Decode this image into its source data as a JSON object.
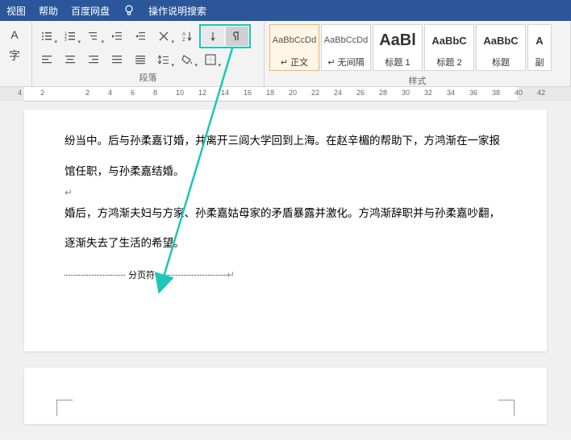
{
  "menubar": {
    "items": [
      "视图",
      "帮助",
      "百度网盘"
    ],
    "tell_me": "操作说明搜索"
  },
  "ribbon": {
    "paragraph_label": "段落",
    "styles_label": "样式"
  },
  "styles": [
    {
      "preview": "AaBbCcDd",
      "label": "↵ 正文",
      "big": false,
      "heading": false,
      "active": true
    },
    {
      "preview": "AaBbCcDd",
      "label": "↵ 无间隔",
      "big": false,
      "heading": false,
      "active": false
    },
    {
      "preview": "AaBl",
      "label": "标题 1",
      "big": true,
      "heading": false,
      "active": false
    },
    {
      "preview": "AaBbC",
      "label": "标题 2",
      "big": false,
      "heading": true,
      "active": false
    },
    {
      "preview": "AaBbC",
      "label": "标题",
      "big": false,
      "heading": true,
      "active": false
    },
    {
      "preview": "A",
      "label": "副",
      "big": false,
      "heading": true,
      "active": false
    }
  ],
  "ruler_marks": [
    -4,
    -2,
    2,
    4,
    6,
    8,
    10,
    12,
    14,
    16,
    18,
    20,
    22,
    24,
    26,
    28,
    30,
    32,
    34,
    36,
    38,
    40,
    42
  ],
  "document": {
    "para1": "纷当中。后与孙柔嘉订婚，并离开三闾大学回到上海。在赵辛楣的帮助下，方鸿渐在一家报馆任职，与孙柔嘉结婚。",
    "para2": "婚后，方鸿渐夫妇与方家、孙柔嘉姑母家的矛盾暴露并激化。方鸿渐辞职并与孙柔嘉吵翻，逐渐失去了生活的希望。",
    "page_break": "分页符"
  }
}
